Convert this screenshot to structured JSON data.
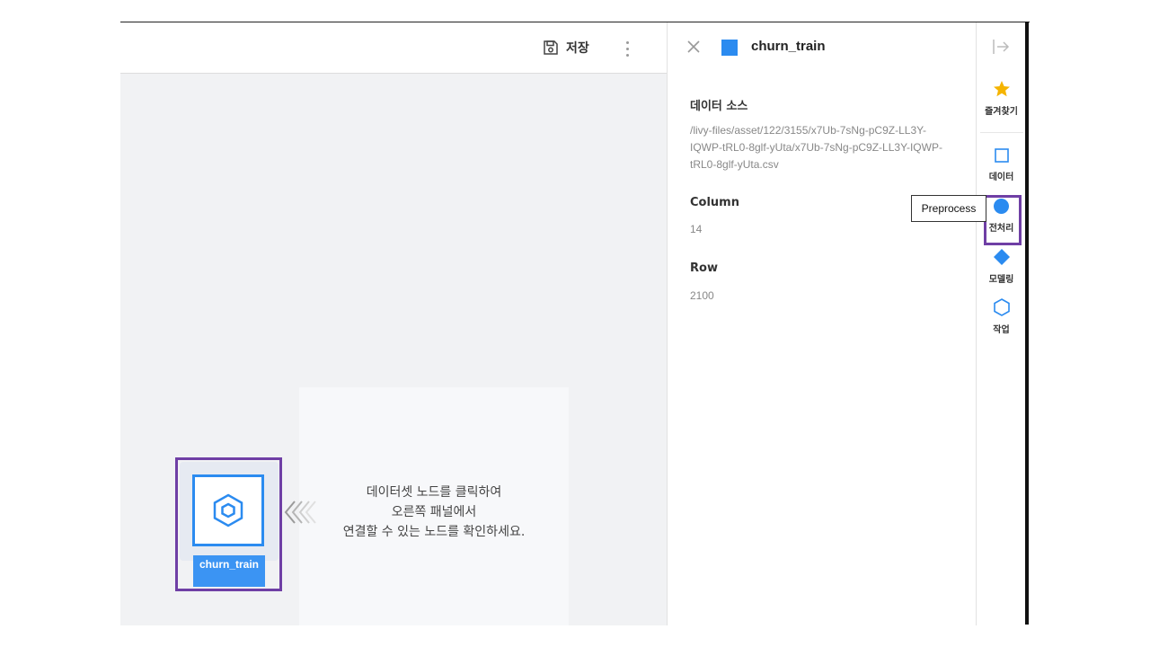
{
  "toolbar": {
    "save_label": "저장"
  },
  "canvas": {
    "hint_lines": [
      "데이터셋 노드를 클릭하여",
      "오른쪽 패널에서",
      "연결할 수 있는 노드를 확인하세요."
    ],
    "node": {
      "label": "churn_train",
      "icon": "hexagon-icon"
    }
  },
  "panel": {
    "title": "churn_train",
    "source_heading": "데이터 소스",
    "source_path_lines": [
      "/livy-files/asset/122/3155/x7Ub-7sNg-pC9Z-LL3Y-",
      "IQWP-tRL0-8glf-yUta/x7Ub-7sNg-pC9Z-LL3Y-IQWP-",
      "tRL0-8glf-yUta.csv"
    ],
    "column_heading": "Column",
    "column_value": "14",
    "row_heading": "Row",
    "row_value": "2100"
  },
  "rail": {
    "items": [
      {
        "label": "즐겨찾기",
        "icon": "star-icon"
      },
      {
        "label": "데이터",
        "icon": "square-icon"
      },
      {
        "label": "전처리",
        "icon": "circle-icon"
      },
      {
        "label": "모델링",
        "icon": "diamond-icon"
      },
      {
        "label": "작업",
        "icon": "hexagon-icon"
      }
    ]
  },
  "tooltip": {
    "text": "Preprocess"
  },
  "colors": {
    "accent": "#2b8bf0",
    "highlight": "#6f3fa5",
    "star": "#f5b400",
    "canvas_bg": "#f1f2f4"
  }
}
